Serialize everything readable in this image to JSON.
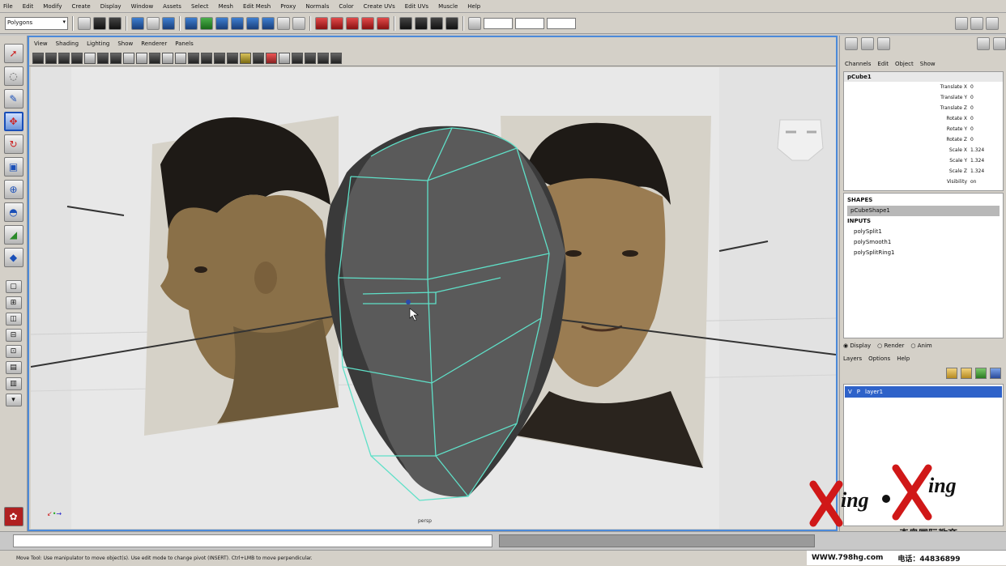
{
  "menubar": [
    "File",
    "Edit",
    "Modify",
    "Create",
    "Display",
    "Window",
    "Assets",
    "Select",
    "Mesh",
    "Edit Mesh",
    "Proxy",
    "Normals",
    "Color",
    "Create UVs",
    "Edit UVs",
    "Muscle",
    "Help"
  ],
  "statusline": {
    "mode": "Polygons"
  },
  "panel": {
    "menu": [
      "View",
      "Shading",
      "Lighting",
      "Show",
      "Renderer",
      "Panels"
    ],
    "camera": "persp"
  },
  "channelbox": {
    "menu": [
      "Channels",
      "Edit",
      "Object",
      "Show"
    ],
    "object": "pCube1",
    "attributes": [
      {
        "label": "Translate X",
        "value": "0"
      },
      {
        "label": "Translate Y",
        "value": "0"
      },
      {
        "label": "Translate Z",
        "value": "0"
      },
      {
        "label": "Rotate X",
        "value": "0"
      },
      {
        "label": "Rotate Y",
        "value": "0"
      },
      {
        "label": "Rotate Z",
        "value": "0"
      },
      {
        "label": "Scale X",
        "value": "1.324"
      },
      {
        "label": "Scale Y",
        "value": "1.324"
      },
      {
        "label": "Scale Z",
        "value": "1.324"
      },
      {
        "label": "Visibility",
        "value": "on"
      }
    ],
    "shapes_head": "SHAPES",
    "shape_selected": "pCubeShape1",
    "inputs_head": "INPUTS",
    "inputs": [
      "polySplit1",
      "polySmooth1",
      "polySplitRing1"
    ]
  },
  "layers": {
    "tabs": [
      "Display",
      "Render",
      "Anim"
    ],
    "menu": [
      "Layers",
      "Options",
      "Help"
    ],
    "row": {
      "v": "V",
      "p": "P",
      "name": "layer1"
    }
  },
  "watermark": {
    "brand": "XING·XING",
    "school": "奇奥国际教育"
  },
  "footer": {
    "url": "WWW.798hg.com",
    "phone": "电话：44836899"
  },
  "helpline": "Move Tool: Use manipulator to move object(s). Use edit mode to change pivot (INSERT). Ctrl+LMB to move perpendicular."
}
